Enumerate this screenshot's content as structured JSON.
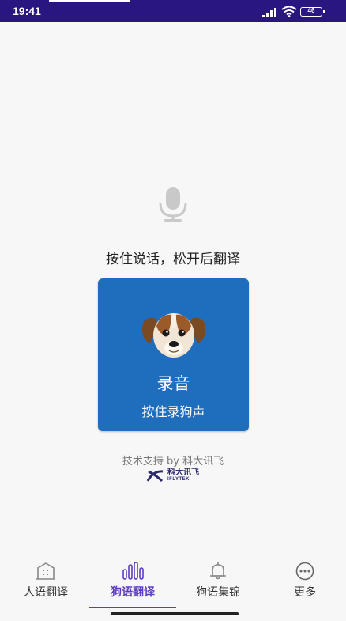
{
  "status_bar": {
    "time": "19:41",
    "battery": "46"
  },
  "main": {
    "hint": "按住说话，松开后翻译",
    "record_title": "录音",
    "record_subtitle": "按住录狗声",
    "support_text": "技术支持 by 科大讯飞",
    "logo_cn": "科大讯飞",
    "logo_en": "IFLYTEK"
  },
  "bottom_nav": {
    "items": [
      {
        "label": "人语翻译",
        "icon": "building-icon"
      },
      {
        "label": "狗语翻译",
        "icon": "bars-icon"
      },
      {
        "label": "狗语集锦",
        "icon": "bell-icon"
      },
      {
        "label": "更多",
        "icon": "more-icon"
      }
    ],
    "active_index": 1
  },
  "colors": {
    "status_bar": "#2a1680",
    "record_card": "#1f6dbd",
    "accent": "#5b3cc4"
  }
}
